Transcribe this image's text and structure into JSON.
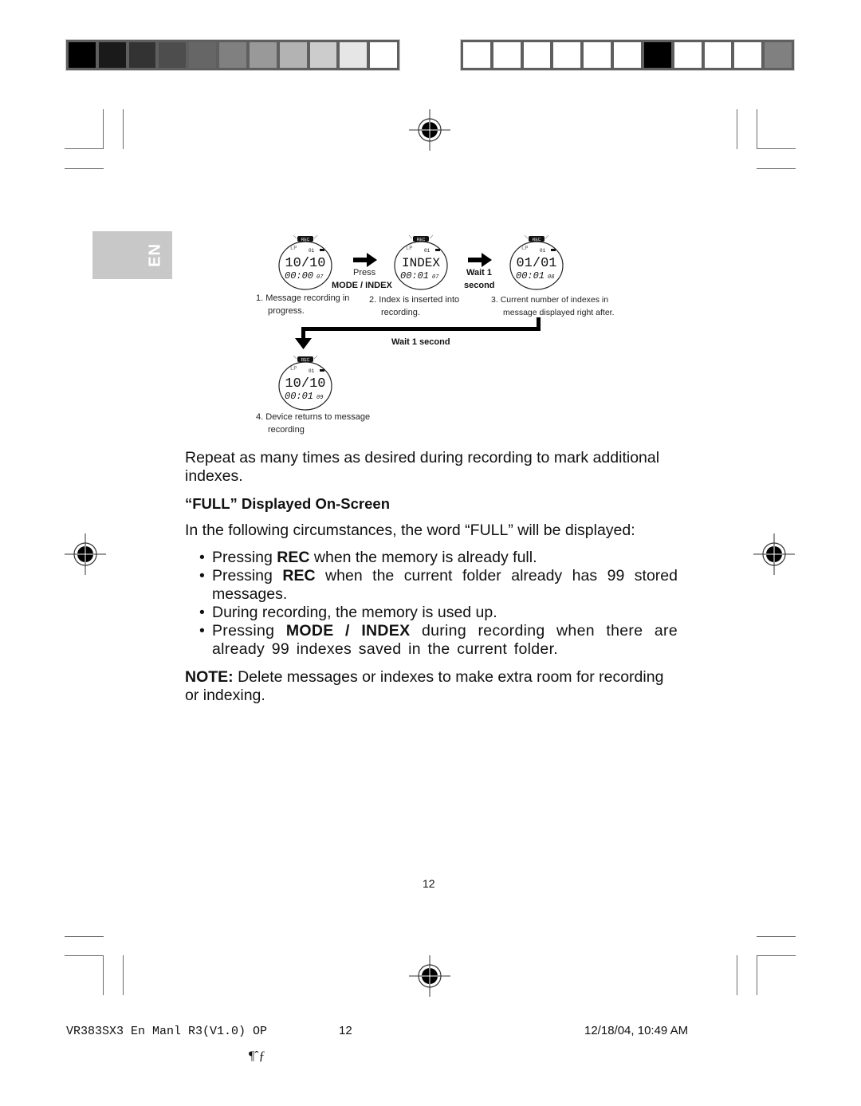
{
  "print_marks": {
    "left_bar_swatches": [
      "#000000",
      "#1a1a1a",
      "#333333",
      "#4d4d4d",
      "#666666",
      "#808080",
      "#999999",
      "#b3b3b3",
      "#cccccc",
      "#e6e6e6",
      "#ffffff"
    ],
    "right_bar_swatches": [
      "#ffffff",
      "#ffffff",
      "#ffffff",
      "#ffffff",
      "#ffffff",
      "#ffffff",
      "#000000",
      "#ffffff",
      "#ffffff",
      "#ffffff",
      "#808080"
    ]
  },
  "language_tab": "EN",
  "diagram": {
    "screens": [
      {
        "top": "10/10",
        "bottom": "00:00",
        "small": "07"
      },
      {
        "top": "INDEX",
        "bottom": "00:01",
        "small": "07"
      },
      {
        "top": "01/01",
        "bottom": "00:01",
        "small": "08"
      },
      {
        "top": "10/10",
        "bottom": "00:01",
        "small": "09"
      }
    ],
    "rec_label": "REC",
    "arrow1_label_top": "Press",
    "arrow1_label_bottom": "MODE / INDEX",
    "arrow2_label_top": "Wait 1",
    "arrow2_label_bottom": "second",
    "return_label": "Wait 1 second",
    "captions": [
      {
        "num": "1.",
        "line1": "Message recording in",
        "line2": "progress."
      },
      {
        "num": "2.",
        "line1": "Index is inserted into",
        "line2": "recording."
      },
      {
        "num": "3.",
        "line1": "Current number of indexes in",
        "line2": "message displayed right after."
      },
      {
        "num": "4.",
        "line1": "Device returns to message",
        "line2": "recording"
      }
    ]
  },
  "content": {
    "intro": "Repeat as many times as desired during recording to mark additional indexes.",
    "heading": "“FULL” Displayed On-Screen",
    "lead": "In the following circumstances, the word “FULL” will be displayed:",
    "bullets": [
      {
        "pre": "Pressing ",
        "bold": "REC",
        "post": " when the memory is already full."
      },
      {
        "pre": "Pressing ",
        "bold": "REC",
        "post": " when the current folder already has 99 stored messages."
      },
      {
        "pre": "During recording, the memory is used up.",
        "bold": "",
        "post": ""
      },
      {
        "pre": "Pressing ",
        "bold": "MODE / INDEX",
        "post": " during recording when there are already 99 indexes saved in the current folder."
      }
    ],
    "note_label": "NOTE:",
    "note_text": " Delete messages or indexes to make extra room for recording or indexing."
  },
  "page_number": "12",
  "footer": {
    "file": "VR383SX3 En Manl R3(V1.0) OP",
    "page": "12",
    "datetime": "12/18/04, 10:49 AM",
    "glyphs": "¶ˆƒ"
  }
}
